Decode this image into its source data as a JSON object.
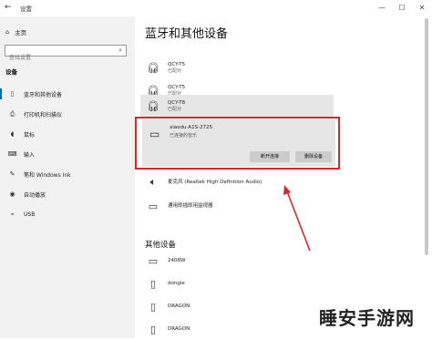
{
  "window": {
    "title": "设置",
    "back_icon": "back-arrow-icon",
    "minimize": "—",
    "maximize": "☐",
    "close": "✕"
  },
  "sidebar": {
    "home": "主页",
    "search_placeholder": "查找设置",
    "section": "设备",
    "items": [
      {
        "label": "蓝牙和其他设备",
        "icon": "bluetooth-icon",
        "active": true
      },
      {
        "label": "打印机和扫描仪",
        "icon": "printer-icon"
      },
      {
        "label": "鼠标",
        "icon": "mouse-icon"
      },
      {
        "label": "输入",
        "icon": "keyboard-icon"
      },
      {
        "label": "笔和 Windows Ink",
        "icon": "pen-icon"
      },
      {
        "label": "自动播放",
        "icon": "autoplay-icon"
      },
      {
        "label": "USB",
        "icon": "usb-icon"
      }
    ]
  },
  "main": {
    "title": "蓝牙和其他设备",
    "audio_devices": [
      {
        "name": "QCY-T5",
        "status": "已配对",
        "icon": "headphones-icon"
      },
      {
        "name": "QCY-T5",
        "status": "已配对",
        "icon": "headphones-icon"
      },
      {
        "name": "QCY-T8",
        "status": "已配对",
        "icon": "headphones-icon"
      }
    ],
    "selected_device": {
      "name": "xiaodu-A1S-2725",
      "status": "已连接的音乐",
      "icon": "speaker-monitor-icon",
      "disconnect": "断开连接",
      "remove": "删除设备"
    },
    "other_audio": [
      {
        "name": "麦克风 (Realtek High Definition Audio)",
        "icon": "volume-icon"
      },
      {
        "name": "通用即插即用监视器",
        "icon": "monitor-icon"
      }
    ],
    "other_title": "其他设备",
    "other_devices": [
      {
        "name": "2408W",
        "icon": "monitor-icon"
      },
      {
        "name": "dongle",
        "icon": "device-icon"
      },
      {
        "name": "DRAGON",
        "icon": "device-icon"
      },
      {
        "name": "DRAGON",
        "icon": "device-icon"
      }
    ]
  },
  "watermark": {
    "text": "睡安手游网"
  },
  "colors": {
    "highlight_box": "#d9262b",
    "accent": "#0067c0",
    "selected_bg": "#e6e6e6"
  }
}
